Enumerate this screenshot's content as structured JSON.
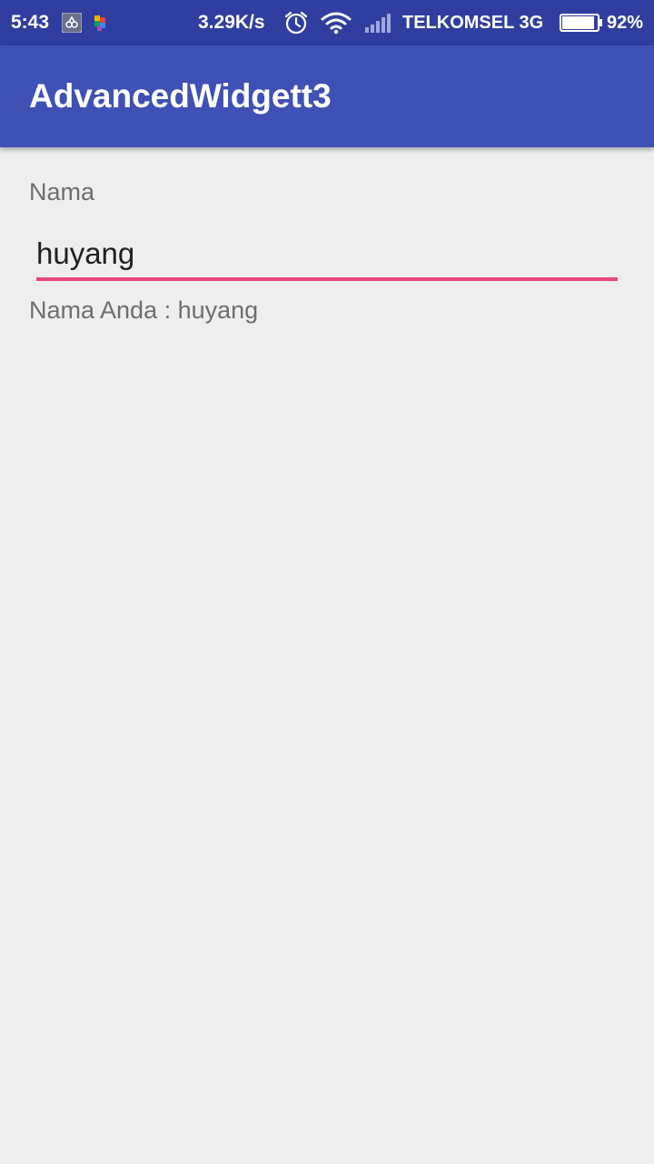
{
  "status_bar": {
    "time": "5:43",
    "net_speed": "3.29K/s",
    "carrier": "TELKOMSEL 3G",
    "battery_percent": "92%",
    "battery_level": 0.92,
    "icons": [
      "notification-app-icon",
      "colorful-app-icon",
      "alarm-icon",
      "wifi-icon",
      "signal-icon",
      "battery-icon"
    ]
  },
  "app_bar": {
    "title": "AdvancedWidgett3"
  },
  "form": {
    "name_label": "Nama",
    "name_value": "huyang",
    "result_prefix": "Nama Anda : ",
    "result_text": "Nama Anda : huyang"
  },
  "colors": {
    "status_bar": "#303f9f",
    "app_bar": "#3f51b5",
    "accent_underline": "#e8457a",
    "background": "#eeeeee"
  }
}
